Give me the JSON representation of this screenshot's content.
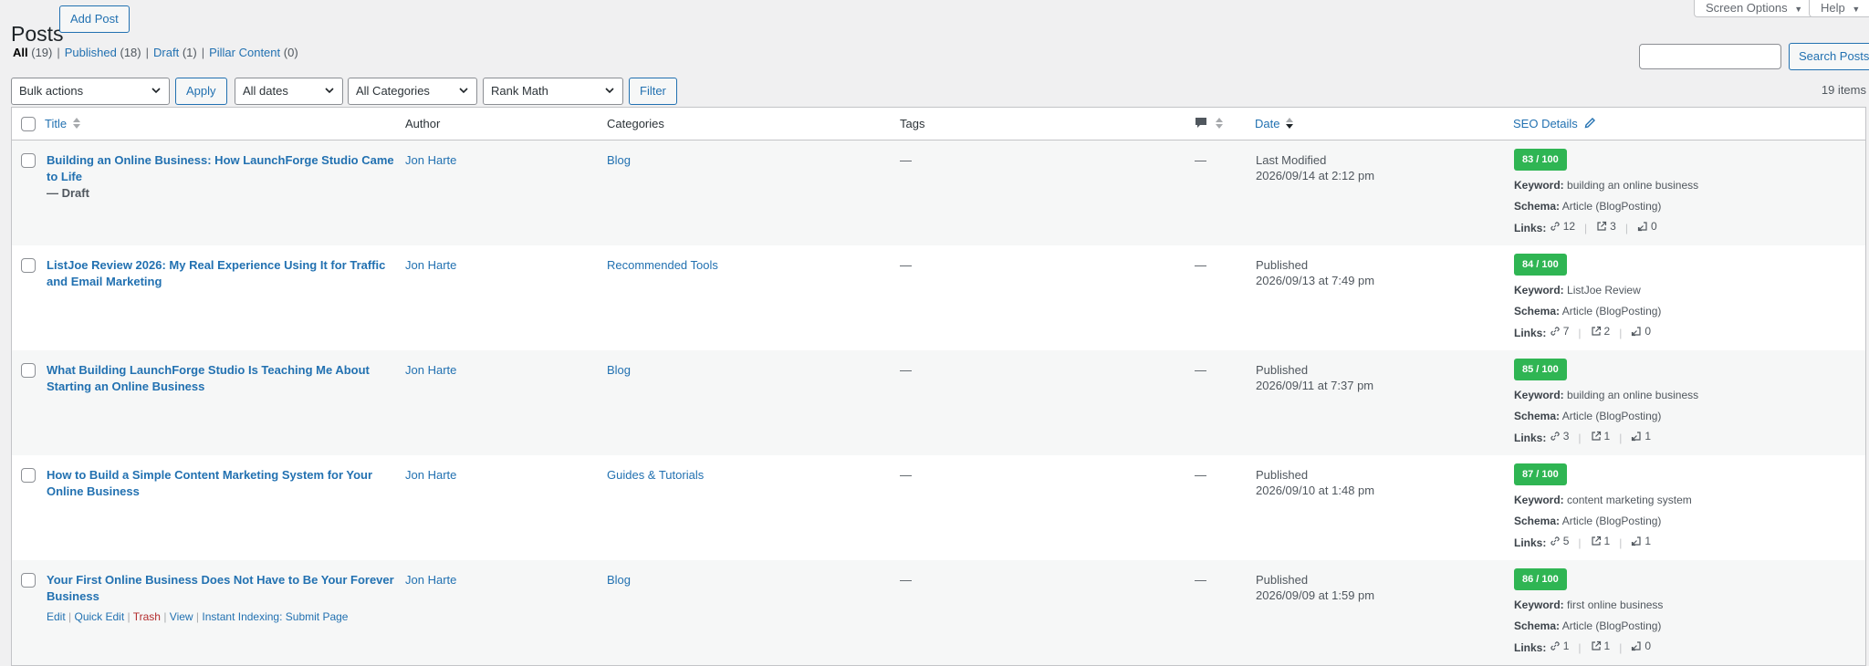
{
  "page": {
    "title": "Posts",
    "add_new": "Add Post"
  },
  "top_tabs": {
    "screen_options": "Screen Options",
    "help": "Help"
  },
  "views": [
    {
      "label": "All",
      "count": "(19)"
    },
    {
      "label": "Published",
      "count": "(18)"
    },
    {
      "label": "Draft",
      "count": "(1)"
    },
    {
      "label": "Pillar Content",
      "count": "(0)"
    }
  ],
  "search": {
    "button": "Search Posts",
    "value": ""
  },
  "filters": {
    "bulk_actions": "Bulk actions",
    "apply": "Apply",
    "dates": "All dates",
    "categories": "All Categories",
    "rank_math": "Rank Math",
    "filter": "Filter"
  },
  "items_count": "19 items",
  "columns": {
    "title": "Title",
    "author": "Author",
    "categories": "Categories",
    "tags": "Tags",
    "date": "Date",
    "seo": "SEO Details"
  },
  "posts": [
    {
      "title": "Building an Online Business: How LaunchForge Studio Came to Life",
      "state": "— Draft",
      "author": "Jon Harte",
      "category": "Blog",
      "tags": "—",
      "comments": "—",
      "date_status": "Last Modified",
      "date": "2026/09/14 at 2:12 pm",
      "score": "83 / 100",
      "keyword": "building an online business",
      "schema": "Article (BlogPosting)",
      "links": [
        "12",
        "3",
        "0"
      ]
    },
    {
      "title": "ListJoe Review 2026: My Real Experience Using It for Traffic and Email Marketing",
      "state": "",
      "author": "Jon Harte",
      "category": "Recommended Tools",
      "tags": "—",
      "comments": "—",
      "date_status": "Published",
      "date": "2026/09/13 at 7:49 pm",
      "score": "84 / 100",
      "keyword": "ListJoe Review",
      "schema": "Article (BlogPosting)",
      "links": [
        "7",
        "2",
        "0"
      ]
    },
    {
      "title": "What Building LaunchForge Studio Is Teaching Me About Starting an Online Business",
      "state": "",
      "author": "Jon Harte",
      "category": "Blog",
      "tags": "—",
      "comments": "—",
      "date_status": "Published",
      "date": "2026/09/11 at 7:37 pm",
      "score": "85 / 100",
      "keyword": "building an online business",
      "schema": "Article (BlogPosting)",
      "links": [
        "3",
        "1",
        "1"
      ]
    },
    {
      "title": "How to Build a Simple Content Marketing System for Your Online Business",
      "state": "",
      "author": "Jon Harte",
      "category": "Guides & Tutorials",
      "tags": "—",
      "comments": "—",
      "date_status": "Published",
      "date": "2026/09/10 at 1:48 pm",
      "score": "87 / 100",
      "keyword": "content marketing system",
      "schema": "Article (BlogPosting)",
      "links": [
        "5",
        "1",
        "1"
      ]
    },
    {
      "title": "Your First Online Business Does Not Have to Be Your Forever Business",
      "state": "",
      "author": "Jon Harte",
      "category": "Blog",
      "tags": "—",
      "comments": "—",
      "date_status": "Published",
      "date": "2026/09/09 at 1:59 pm",
      "score": "86 / 100",
      "keyword": "first online business",
      "schema": "Article (BlogPosting)",
      "links": [
        "1",
        "1",
        "0"
      ]
    }
  ],
  "row_actions": {
    "edit": "Edit",
    "quick_edit": "Quick Edit",
    "trash": "Trash",
    "view": "View",
    "instant_indexing": "Instant Indexing: Submit Page"
  },
  "seo_labels": {
    "keyword": "Keyword:",
    "schema": "Schema:",
    "links": "Links:"
  },
  "colors": {
    "link": "#2271b1",
    "score_green": "#2fb553",
    "trash_red": "#b32d2e",
    "background": "#f0f0f1"
  }
}
